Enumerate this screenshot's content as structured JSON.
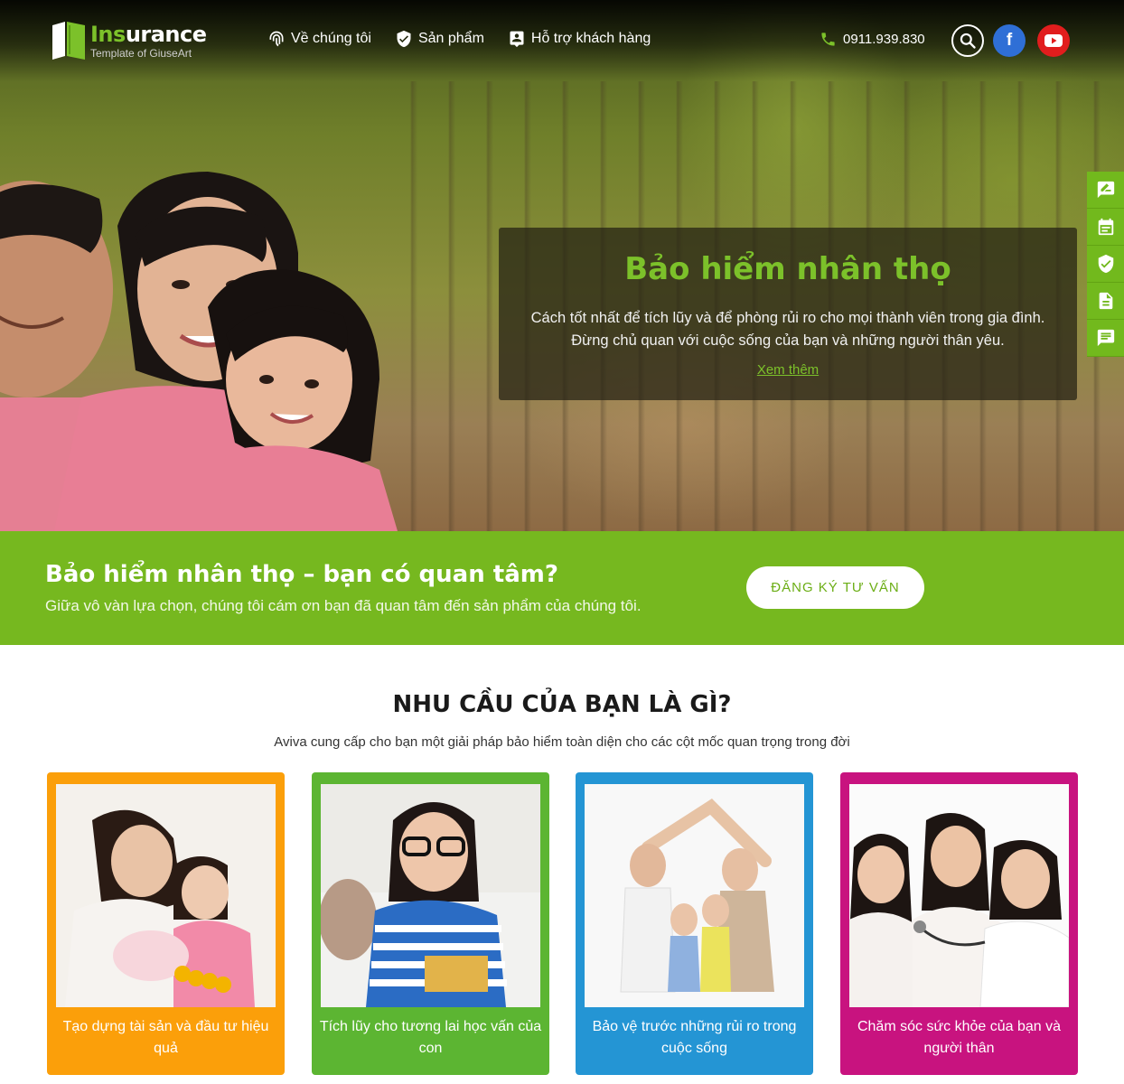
{
  "logo": {
    "brand_prefix": "Ins",
    "brand_suffix": "urance",
    "tagline": "Template of GiuseArt"
  },
  "nav": {
    "items": [
      {
        "label": "Về chúng tôi",
        "icon": "fingerprint-icon"
      },
      {
        "label": "Sản phẩm",
        "icon": "shield-check-icon"
      },
      {
        "label": "Hỗ trợ khách hàng",
        "icon": "user-support-icon"
      }
    ]
  },
  "header": {
    "phone": "0911.939.830",
    "facebook_label": "f"
  },
  "hero": {
    "title": "Bảo hiểm nhân thọ",
    "description": "Cách tốt nhất để tích lũy và để phòng rủi ro cho mọi thành viên trong gia đình. Đừng chủ quan với cuộc sống của bạn và những người thân yêu.",
    "more_link": "Xem thêm"
  },
  "side_tools": [
    "edit-icon",
    "calendar-icon",
    "shield-check-icon",
    "document-icon",
    "chat-icon"
  ],
  "cta": {
    "title": "Bảo hiểm nhân thọ – bạn có quan tâm?",
    "description": "Giữa vô vàn lựa chọn, chúng tôi cám ơn bạn đã quan tâm đến sản phẩm của chúng tôi.",
    "button": "ĐĂNG KÝ TƯ VẤN"
  },
  "needs": {
    "title": "NHU CẦU CỦA BẠN LÀ GÌ?",
    "subtitle": "Aviva cung cấp cho bạn một giải pháp bảo hiểm toàn diện cho các cột mốc quan trọng trong đời",
    "cards": [
      {
        "label": "Tạo dựng tài sản và đầu tư hiệu quả",
        "color": "#fb9f0a"
      },
      {
        "label": "Tích lũy cho tương lai học vấn của con",
        "color": "#5cb532"
      },
      {
        "label": "Bảo vệ trước những rủi ro trong cuộc sống",
        "color": "#2495d4"
      },
      {
        "label": "Chăm sóc sức khỏe của bạn và người thân",
        "color": "#c8137f"
      }
    ]
  },
  "colors": {
    "accent": "#7cc12a",
    "cta_bg": "#76b81f",
    "facebook": "#2f6fd6",
    "youtube": "#e11d1d"
  }
}
